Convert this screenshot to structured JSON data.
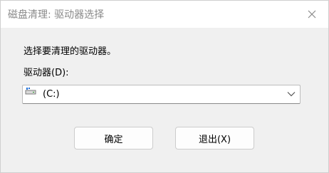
{
  "window": {
    "title": "磁盘清理: 驱动器选择"
  },
  "dialog": {
    "instruction": "选择要清理的驱动器。",
    "drive_label": "驱动器(D):",
    "selected_drive": "(C:)",
    "ok_label": "确定",
    "exit_label": "退出(X)"
  },
  "icons": {
    "close": "close-icon",
    "drive": "drive-icon",
    "dropdown": "chevron-down-icon"
  },
  "colors": {
    "title_text": "#8a8a8a",
    "background": "#f0f0f0"
  }
}
